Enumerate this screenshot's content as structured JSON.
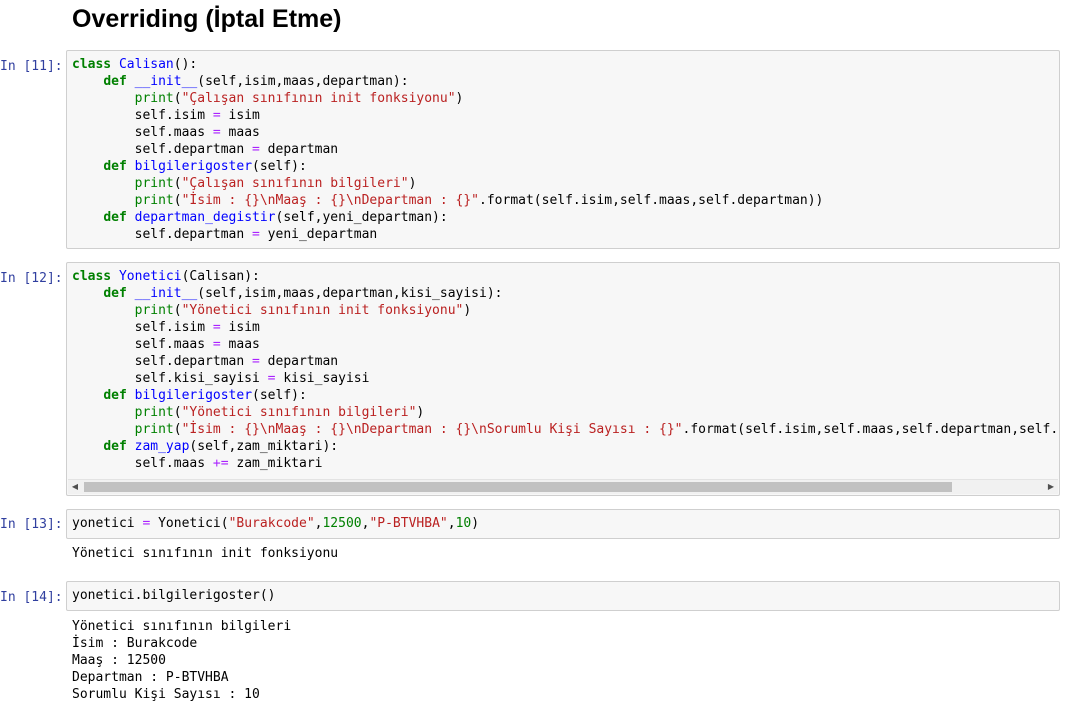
{
  "heading": "Overriding (İptal Etme)",
  "cells": [
    {
      "prompt": "In [11]:",
      "lines": [
        [
          [
            "kw",
            "class"
          ],
          [
            "",
            ""
          ],
          [
            "def",
            " Calisan"
          ],
          [
            "",
            "():"
          ]
        ],
        [
          [
            "",
            "    "
          ],
          [
            "kw",
            "def"
          ],
          [
            "",
            " "
          ],
          [
            "def",
            "__init__"
          ],
          [
            "",
            "(self,isim,maas,departman):"
          ]
        ],
        [
          [
            "",
            "        "
          ],
          [
            "bi",
            "print"
          ],
          [
            "",
            "("
          ],
          [
            "str",
            "\"Çalışan sınıfının init fonksiyonu\""
          ],
          [
            "",
            ")"
          ]
        ],
        [
          [
            "",
            "        self.isim "
          ],
          [
            "op",
            "="
          ],
          [
            "",
            " isim"
          ]
        ],
        [
          [
            "",
            "        self.maas "
          ],
          [
            "op",
            "="
          ],
          [
            "",
            " maas"
          ]
        ],
        [
          [
            "",
            "        self.departman "
          ],
          [
            "op",
            "="
          ],
          [
            "",
            " departman"
          ]
        ],
        [
          [
            "",
            "    "
          ],
          [
            "kw",
            "def"
          ],
          [
            "",
            " "
          ],
          [
            "def",
            "bilgilerigoster"
          ],
          [
            "",
            "(self):"
          ]
        ],
        [
          [
            "",
            "        "
          ],
          [
            "bi",
            "print"
          ],
          [
            "",
            "("
          ],
          [
            "str",
            "\"Çalışan sınıfının bilgileri\""
          ],
          [
            "",
            ")"
          ]
        ],
        [
          [
            "",
            "        "
          ],
          [
            "bi",
            "print"
          ],
          [
            "",
            "("
          ],
          [
            "str",
            "\"İsim : {}\\nMaaş : {}\\nDepartman : {}\""
          ],
          [
            "",
            ".format(self.isim,self.maas,self.departman))"
          ]
        ],
        [
          [
            "",
            "    "
          ],
          [
            "kw",
            "def"
          ],
          [
            "",
            " "
          ],
          [
            "def",
            "departman_degistir"
          ],
          [
            "",
            "(self,yeni_departman):"
          ]
        ],
        [
          [
            "",
            "        self.departman "
          ],
          [
            "op",
            "="
          ],
          [
            "",
            " yeni_departman"
          ]
        ]
      ]
    },
    {
      "prompt": "In [12]:",
      "lines": [
        [
          [
            "kw",
            "class"
          ],
          [
            "def",
            " Yonetici"
          ],
          [
            "",
            "(Calisan):"
          ]
        ],
        [
          [
            "",
            "    "
          ],
          [
            "kw",
            "def"
          ],
          [
            "",
            " "
          ],
          [
            "def",
            "__init__"
          ],
          [
            "",
            "(self,isim,maas,departman,kisi_sayisi):"
          ]
        ],
        [
          [
            "",
            "        "
          ],
          [
            "bi",
            "print"
          ],
          [
            "",
            "("
          ],
          [
            "str",
            "\"Yönetici sınıfının init fonksiyonu\""
          ],
          [
            "",
            ")"
          ]
        ],
        [
          [
            "",
            "        self.isim "
          ],
          [
            "op",
            "="
          ],
          [
            "",
            " isim"
          ]
        ],
        [
          [
            "",
            "        self.maas "
          ],
          [
            "op",
            "="
          ],
          [
            "",
            " maas"
          ]
        ],
        [
          [
            "",
            "        self.departman "
          ],
          [
            "op",
            "="
          ],
          [
            "",
            " departman"
          ]
        ],
        [
          [
            "",
            "        self.kisi_sayisi "
          ],
          [
            "op",
            "="
          ],
          [
            "",
            " kisi_sayisi"
          ]
        ],
        [
          [
            "",
            "    "
          ],
          [
            "kw",
            "def"
          ],
          [
            "",
            " "
          ],
          [
            "def",
            "bilgilerigoster"
          ],
          [
            "",
            "(self):"
          ]
        ],
        [
          [
            "",
            "        "
          ],
          [
            "bi",
            "print"
          ],
          [
            "",
            "("
          ],
          [
            "str",
            "\"Yönetici sınıfının bilgileri\""
          ],
          [
            "",
            ")"
          ]
        ],
        [
          [
            "",
            "        "
          ],
          [
            "bi",
            "print"
          ],
          [
            "",
            "("
          ],
          [
            "str",
            "\"İsim : {}\\nMaaş : {}\\nDepartman : {}\\nSorumlu Kişi Sayısı : {}\""
          ],
          [
            "",
            ".format(self.isim,self.maas,self.departman,self.kis"
          ]
        ],
        [
          [
            "",
            "    "
          ],
          [
            "kw",
            "def"
          ],
          [
            "",
            " "
          ],
          [
            "def",
            "zam_yap"
          ],
          [
            "",
            "(self,zam_miktari):"
          ]
        ],
        [
          [
            "",
            "        self.maas "
          ],
          [
            "op",
            "+="
          ],
          [
            "",
            " zam_miktari"
          ]
        ]
      ]
    },
    {
      "prompt": "In [13]:",
      "lines": [
        [
          [
            "",
            "yonetici "
          ],
          [
            "op",
            "="
          ],
          [
            "",
            " Yonetici("
          ],
          [
            "str",
            "\"Burakcode\""
          ],
          [
            "",
            ","
          ],
          [
            "num",
            "12500"
          ],
          [
            "",
            ","
          ],
          [
            "str",
            "\"P-BTVHBA\""
          ],
          [
            "",
            ","
          ],
          [
            "num",
            "10"
          ],
          [
            "",
            ")"
          ]
        ]
      ],
      "output": "Yönetici sınıfının init fonksiyonu"
    },
    {
      "prompt": "In [14]:",
      "lines": [
        [
          [
            "",
            "yonetici.bilgilerigoster()"
          ]
        ]
      ],
      "output": "Yönetici sınıfının bilgileri\nİsim : Burakcode\nMaaş : 12500\nDepartman : P-BTVHBA\nSorumlu Kişi Sayısı : 10"
    }
  ],
  "scrollbar": {
    "left_arrow": "◀",
    "right_arrow": "▶"
  },
  "colors": {
    "prompt": "#303f9f",
    "keyword": "#008000",
    "definition": "#0000ff",
    "string": "#ba2121",
    "operator": "#aa22ff",
    "cell_background": "#f7f7f7"
  }
}
